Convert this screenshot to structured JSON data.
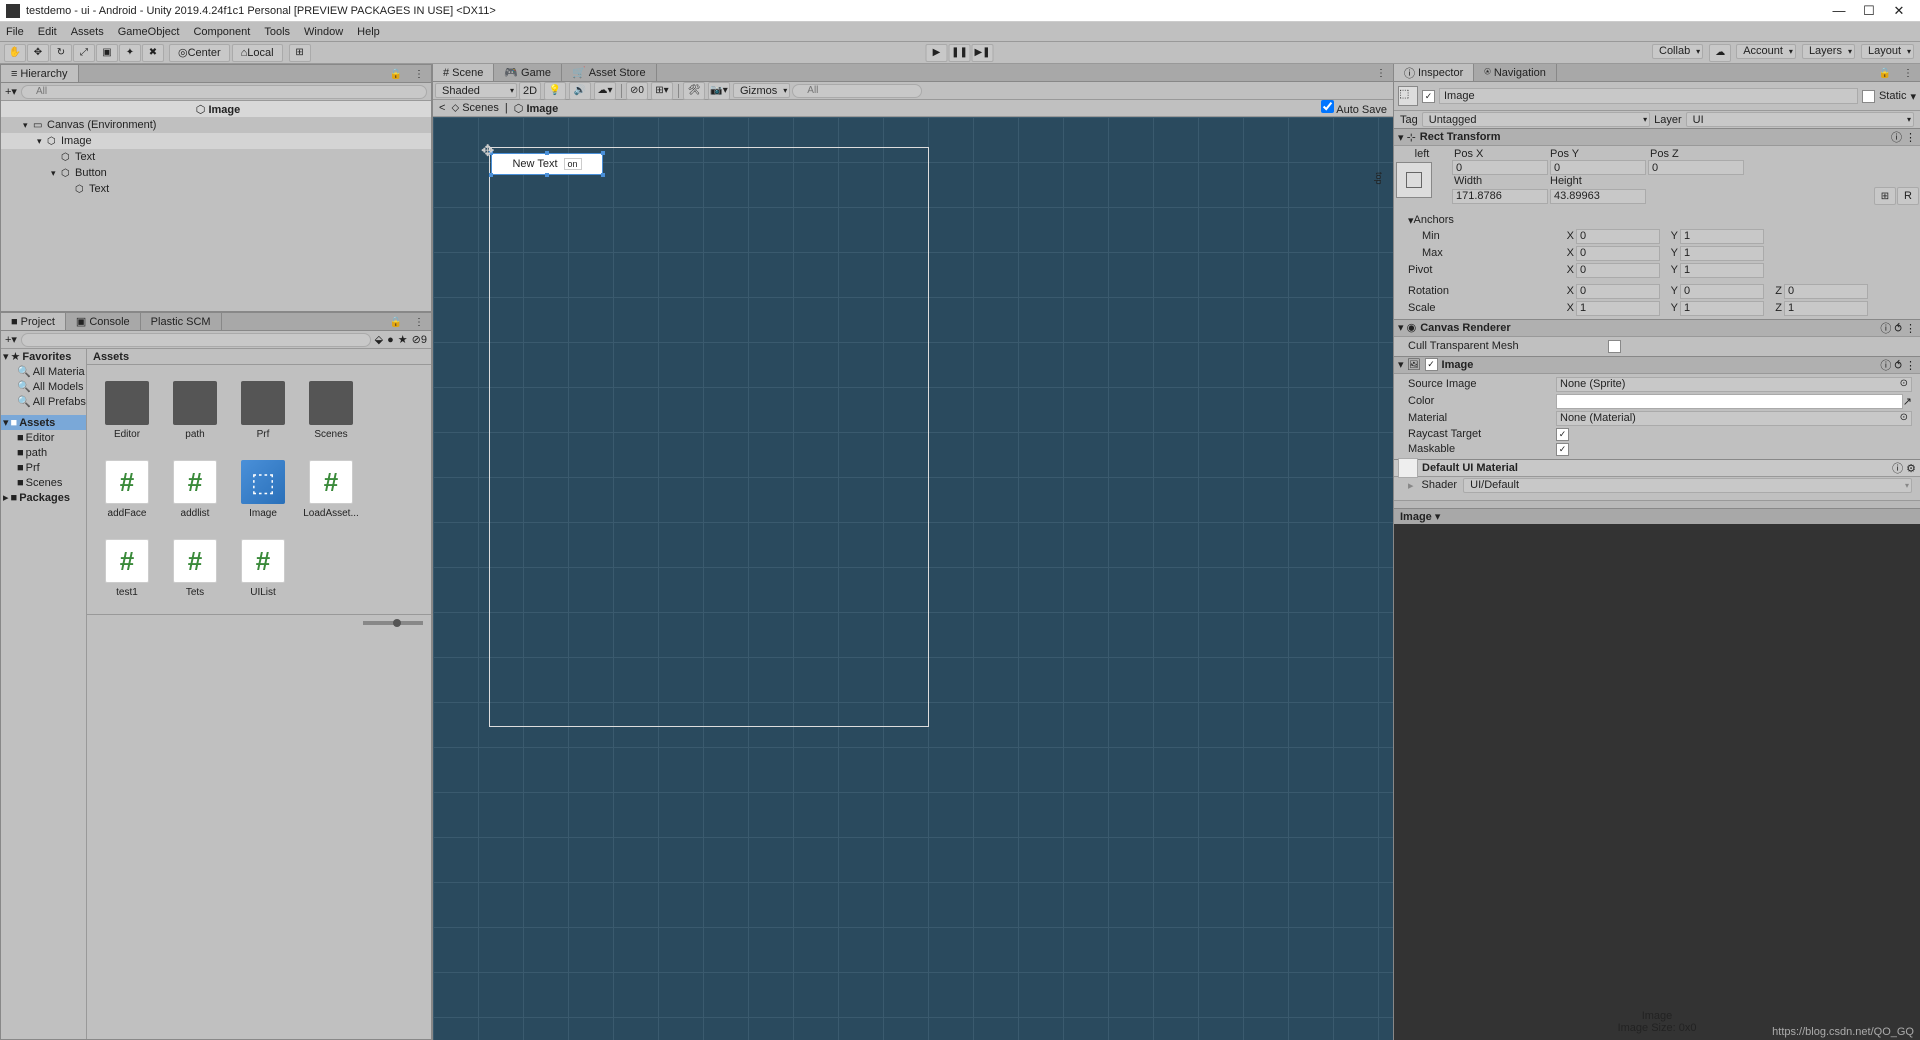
{
  "window": {
    "title": "testdemo - ui - Android - Unity 2019.4.24f1c1 Personal [PREVIEW PACKAGES IN USE] <DX11>"
  },
  "menu": [
    "File",
    "Edit",
    "Assets",
    "GameObject",
    "Component",
    "Tools",
    "Window",
    "Help"
  ],
  "toolbar": {
    "pivot": "Center",
    "space": "Local",
    "collab": "Collab",
    "account": "Account",
    "layers": "Layers",
    "layout": "Layout"
  },
  "search_placeholder": "All",
  "hierarchy": {
    "tab": "Hierarchy",
    "root": "Image",
    "items": [
      {
        "name": "Canvas (Environment)",
        "indent": 0,
        "expanded": true,
        "dim": true
      },
      {
        "name": "Image",
        "indent": 1,
        "expanded": true,
        "selected": true
      },
      {
        "name": "Text",
        "indent": 2
      },
      {
        "name": "Button",
        "indent": 2,
        "expanded": true
      },
      {
        "name": "Text",
        "indent": 3
      }
    ]
  },
  "project": {
    "tabs": [
      "Project",
      "Console",
      "Plastic SCM"
    ],
    "count9": "9",
    "favorites": {
      "label": "Favorites",
      "items": [
        "All Materia",
        "All Models",
        "All Prefabs"
      ]
    },
    "assets": {
      "label": "Assets",
      "items": [
        "Editor",
        "path",
        "Prf",
        "Scenes"
      ]
    },
    "packages": "Packages",
    "header": "Assets",
    "grid": [
      {
        "name": "Editor",
        "type": "folder"
      },
      {
        "name": "path",
        "type": "folder"
      },
      {
        "name": "Prf",
        "type": "folder"
      },
      {
        "name": "Scenes",
        "type": "folder"
      },
      {
        "name": "addFace",
        "type": "script"
      },
      {
        "name": "addlist",
        "type": "script"
      },
      {
        "name": "Image",
        "type": "prefab"
      },
      {
        "name": "LoadAsset...",
        "type": "script"
      },
      {
        "name": "test1",
        "type": "script"
      },
      {
        "name": "Tets",
        "type": "script"
      },
      {
        "name": "UIList",
        "type": "script"
      }
    ]
  },
  "scene": {
    "tabs": [
      "Scene",
      "Game",
      "Asset Store"
    ],
    "shading": "Shaded",
    "dim": "2D",
    "gizmos": "Gizmos",
    "breadcrumb": [
      "Scenes",
      "Image"
    ],
    "autosave": "Auto Save",
    "object_text": "New Text",
    "object_btn": "on"
  },
  "inspector": {
    "tabs": [
      "Inspector",
      "Navigation"
    ],
    "name": "Image",
    "static": "Static",
    "tag_label": "Tag",
    "tag": "Untagged",
    "layer_label": "Layer",
    "layer": "UI",
    "rect": {
      "title": "Rect Transform",
      "anchor": "left",
      "anchor2": "top",
      "posx_l": "Pos X",
      "posy_l": "Pos Y",
      "posz_l": "Pos Z",
      "posx": "0",
      "posy": "0",
      "posz": "0",
      "w_l": "Width",
      "h_l": "Height",
      "w": "171.8786",
      "h": "43.89963",
      "anchors": "Anchors",
      "min_l": "Min",
      "minx": "0",
      "miny": "1",
      "max_l": "Max",
      "maxx": "0",
      "maxy": "1",
      "pivot_l": "Pivot",
      "pivx": "0",
      "pivy": "1",
      "rot_l": "Rotation",
      "rx": "0",
      "ry": "0",
      "rz": "0",
      "scale_l": "Scale",
      "sx": "1",
      "sy": "1",
      "sz": "1",
      "R": "R"
    },
    "cr": {
      "title": "Canvas Renderer",
      "cull": "Cull Transparent Mesh"
    },
    "img": {
      "title": "Image",
      "src_l": "Source Image",
      "src": "None (Sprite)",
      "color_l": "Color",
      "mat_l": "Material",
      "mat": "None (Material)",
      "ray_l": "Raycast Target",
      "mask_l": "Maskable"
    },
    "defmat": {
      "title": "Default UI Material",
      "shader_l": "Shader",
      "shader": "UI/Default"
    },
    "preview": {
      "tab": "Image",
      "name": "Image",
      "size": "Image Size: 0x0"
    }
  },
  "watermark": "https://blog.csdn.net/QO_GQ"
}
